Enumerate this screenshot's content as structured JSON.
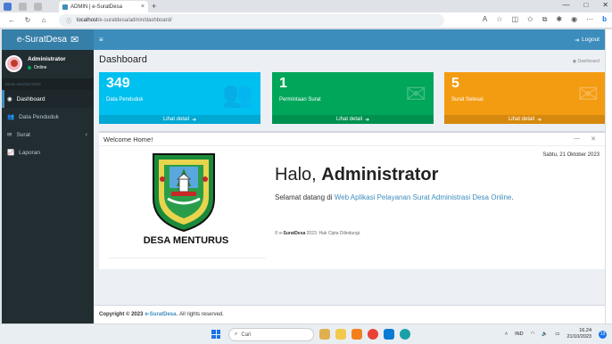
{
  "browser": {
    "tab_title": "ADMIN | e-SuratDesa",
    "tab_close": "×",
    "new_tab": "+",
    "url_host": "localhost",
    "url_path": "/e-suratdesa/admin/dashboard/",
    "window_controls": [
      "—",
      "□",
      "✕"
    ]
  },
  "sidebar": {
    "logo": "e-SuratDesa",
    "user_name": "Administrator",
    "user_status": "Online",
    "menu_header": "MAIN NAVIGATION",
    "items": [
      {
        "label": "Dashboard",
        "icon": "dashboard-icon"
      },
      {
        "label": "Data Penduduk",
        "icon": "users-icon"
      },
      {
        "label": "Surat",
        "icon": "mail-icon"
      },
      {
        "label": "Laporan",
        "icon": "chart-icon"
      }
    ]
  },
  "navbar": {
    "toggle": "≡",
    "logout": "Logout"
  },
  "page": {
    "title": "Dashboard",
    "breadcrumb": "Dashboard"
  },
  "stats": [
    {
      "value": "349",
      "label": "Data Penduduk",
      "link": "Lihat detail",
      "color": "#00c0ef"
    },
    {
      "value": "1",
      "label": "Permintaan Surat",
      "link": "Lihat detail",
      "color": "#00a65a"
    },
    {
      "value": "5",
      "label": "Surat Selesai",
      "link": "Lihat detail",
      "color": "#f39c12"
    }
  ],
  "welcome": {
    "box_title": "Welcome Home!",
    "collapse": "—",
    "close": "✕",
    "village": "DESA MENTURUS",
    "date": "Sabtu, 21 Oktober 2023",
    "greeting": "Halo, ",
    "greeting_name": "Administrator",
    "intro": "Selamat datang di ",
    "app_name": "Web Aplikasi Pelayanan Surat Administrasi Desa Online",
    "intro_end": ".",
    "copy_prefix": "© e-",
    "copy_brand": "SuratDesa",
    "copy_suffix": " 2023. Hak Cipta Dilindungi."
  },
  "footer": {
    "copyright": "Copyright © 2023",
    "brand": "e-SuratDesa.",
    "rights": "All rights reserved."
  },
  "taskbar": {
    "search": "Cari",
    "lang": "IND",
    "time": "16.24",
    "date": "21/10/2023",
    "notifications": "13"
  },
  "colors": {
    "sidebar": "#222d32",
    "navbar": "#3c8dbc",
    "accent": "#3c8dbc"
  }
}
